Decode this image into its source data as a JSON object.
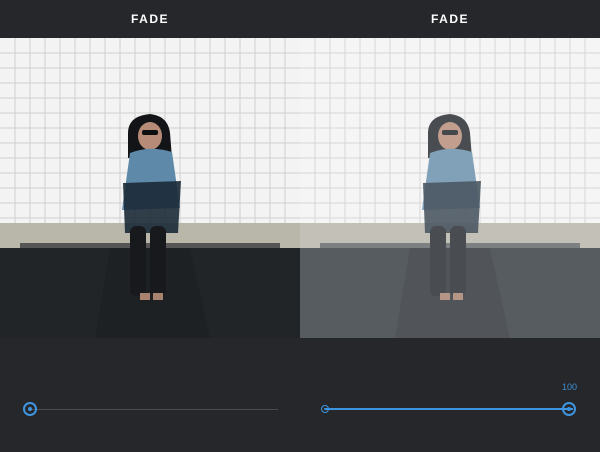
{
  "left_panel": {
    "title": "FADE",
    "slider_value": 0
  },
  "right_panel": {
    "title": "FADE",
    "slider_value_label": "100",
    "slider_value": 100
  },
  "colors": {
    "background": "#26272b",
    "accent": "#3d95e0",
    "track": "#4a4c50"
  }
}
